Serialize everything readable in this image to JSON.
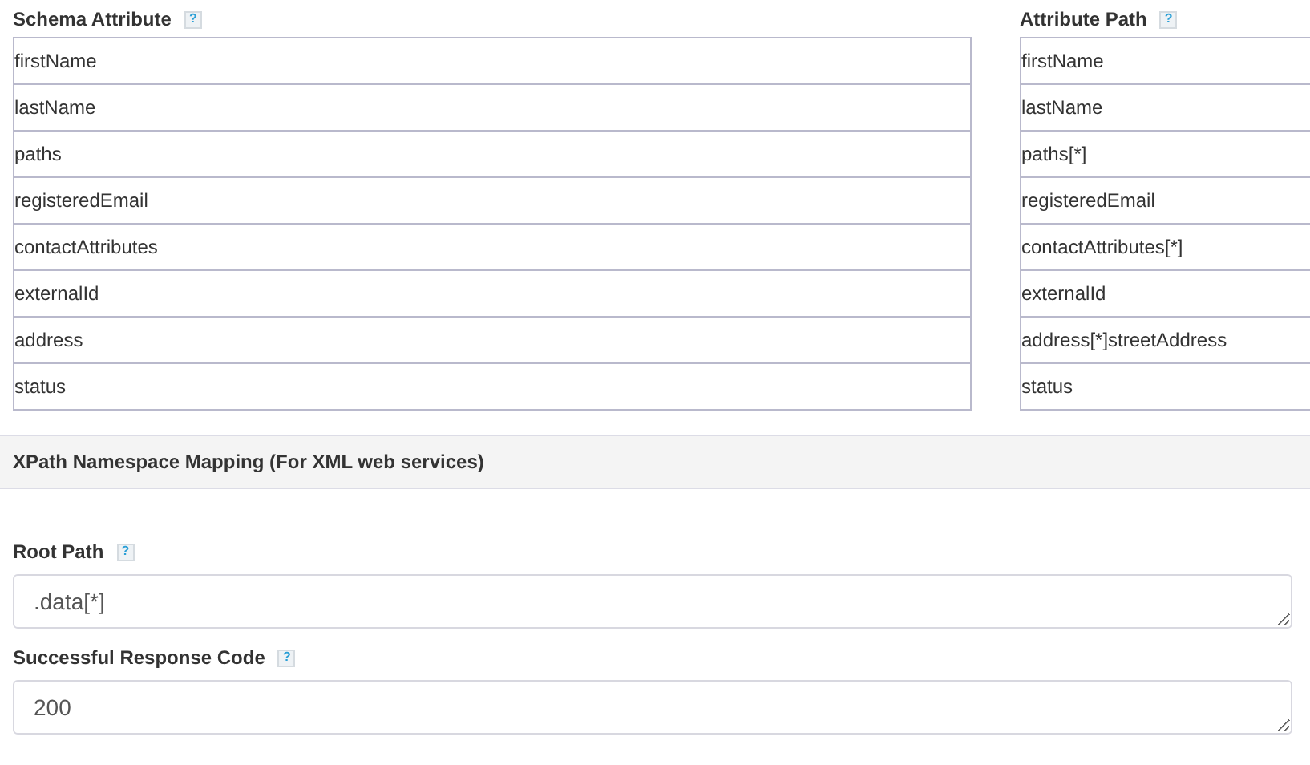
{
  "mapping": {
    "columns": [
      {
        "title": "Schema Attribute",
        "help": "?"
      },
      {
        "title": "Attribute Path",
        "help": "?"
      }
    ],
    "rows": [
      {
        "attribute": "firstName",
        "path": "firstName"
      },
      {
        "attribute": "lastName",
        "path": "lastName"
      },
      {
        "attribute": "paths",
        "path": "paths[*]"
      },
      {
        "attribute": "registeredEmail",
        "path": "registeredEmail"
      },
      {
        "attribute": "contactAttributes",
        "path": "contactAttributes[*]"
      },
      {
        "attribute": "externalId",
        "path": "externalId"
      },
      {
        "attribute": "address",
        "path": "address[*]streetAddress"
      },
      {
        "attribute": "status",
        "path": "status"
      }
    ]
  },
  "section": {
    "title": "XPath Namespace Mapping (For XML web services)"
  },
  "fields": [
    {
      "label": "Root Path",
      "help": "?",
      "value": ".data[*]"
    },
    {
      "label": "Successful Response Code",
      "help": "?",
      "value": "200"
    }
  ]
}
